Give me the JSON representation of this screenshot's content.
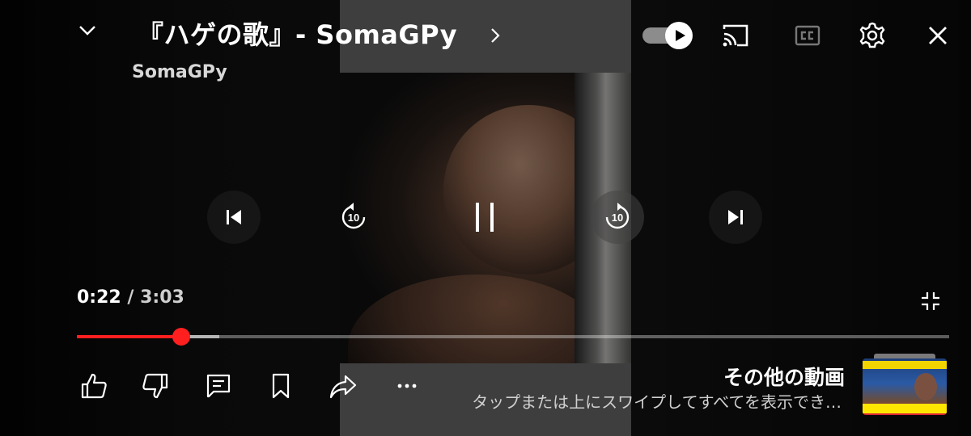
{
  "header": {
    "title": "『ハゲの歌』- SomaGPy",
    "channel": "SomaGPy"
  },
  "player": {
    "current_time": "0:22",
    "separator": " / ",
    "duration": "3:03",
    "progress_fraction": 0.12,
    "buffered_fraction": 0.163,
    "autoplay_on": true
  },
  "icons": {
    "minimize": "chevron-down-icon",
    "title_more": "chevron-right-icon",
    "autoplay": "autoplay-toggle-icon",
    "cast": "cast-icon",
    "captions": "cc-icon",
    "settings": "gear-icon",
    "close": "close-icon",
    "previous": "skip-previous-icon",
    "rewind": "replay-10-icon",
    "pause": "pause-icon",
    "forward": "forward-10-icon",
    "next": "skip-next-icon",
    "exit_fullscreen": "fullscreen-exit-icon",
    "like": "thumbs-up-icon",
    "dislike": "thumbs-down-icon",
    "comments": "comment-icon",
    "save": "bookmark-icon",
    "share": "share-icon",
    "more": "more-horizontal-icon"
  },
  "seek_labels": {
    "rewind": "10",
    "forward": "10"
  },
  "more_videos": {
    "title": "その他の動画",
    "subtitle": "タップまたは上にスワイプしてすべてを表示でき…"
  },
  "colors": {
    "accent_red": "#ff1f1f",
    "video_letterbox": "#6c6c6c"
  }
}
